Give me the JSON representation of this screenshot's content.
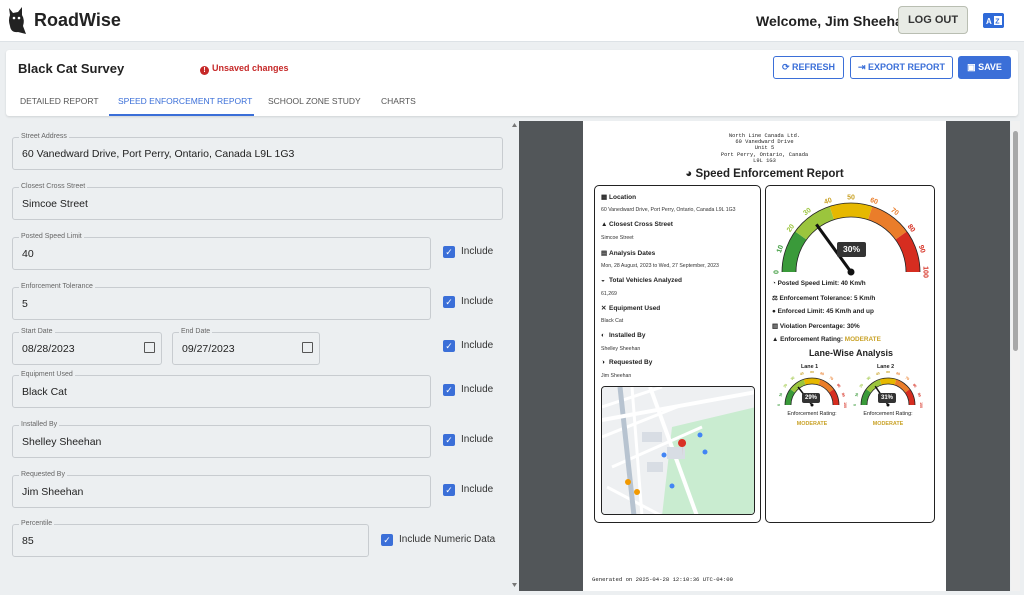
{
  "app": {
    "name": "RoadWise",
    "welcome": "Welcome, Jim Sheehan!",
    "logout_label": "LOG OUT"
  },
  "survey": {
    "title": "Black Cat Survey",
    "unsaved": "Unsaved changes",
    "buttons": {
      "refresh": "REFRESH",
      "export": "EXPORT REPORT",
      "save": "SAVE"
    },
    "tabs": [
      "DETAILED REPORT",
      "SPEED ENFORCEMENT REPORT",
      "SCHOOL ZONE STUDY",
      "CHARTS"
    ]
  },
  "form": {
    "street_address": {
      "label": "Street Address",
      "value": "60 Vanedward Drive, Port Perry, Ontario, Canada L9L 1G3"
    },
    "cross_street": {
      "label": "Closest Cross Street",
      "value": "Simcoe Street"
    },
    "speed_limit": {
      "label": "Posted Speed Limit",
      "value": "40"
    },
    "tolerance": {
      "label": "Enforcement Tolerance",
      "value": "5"
    },
    "start_date": {
      "label": "Start Date",
      "value": "08/28/2023"
    },
    "end_date": {
      "label": "End Date",
      "value": "09/27/2023"
    },
    "equipment": {
      "label": "Equipment Used",
      "value": "Black Cat"
    },
    "installed_by": {
      "label": "Installed By",
      "value": "Shelley Sheehan"
    },
    "requested_by": {
      "label": "Requested By",
      "value": "Jim Sheehan"
    },
    "percentile": {
      "label": "Percentile",
      "value": "85"
    },
    "include_label": "Include",
    "include_numeric_label": "Include Numeric Data",
    "include_states": {
      "speed_limit": true,
      "tolerance": true,
      "dates": true,
      "equipment": true,
      "installed_by": true,
      "requested_by": true,
      "numeric": true
    }
  },
  "report": {
    "address_lines": [
      "North Line Canada Ltd.",
      "60 Vanedward Drive",
      "Unit 5",
      "Port Perry, Ontario, Canada",
      "L9L 1G3"
    ],
    "title": "Speed Enforcement Report",
    "location_label": "Location",
    "location_value": "60 Vanedward Drive, Port Perry, Ontario, Canada L9L 1G3",
    "cross_label": "Closest Cross Street",
    "cross_value": "Simcoe Street",
    "dates_label": "Analysis Dates",
    "dates_value": "Mon, 28 August, 2023 to Wed, 27 September, 2023",
    "vehicles_label": "Total Vehicles Analyzed",
    "vehicles_value": "61,269",
    "equipment_label": "Equipment Used",
    "equipment_value": "Black Cat",
    "installed_label": "Installed By",
    "installed_value": "Shelley Sheehan",
    "requested_label": "Requested By",
    "requested_value": "Jim Sheehan",
    "gauge_ticks": [
      "0",
      "10",
      "20",
      "30",
      "40",
      "50",
      "60",
      "70",
      "80",
      "90",
      "100"
    ],
    "gauge_value": 30,
    "gauge_label": "30%",
    "posted_speed": "Posted Speed Limit: 40 Km/h",
    "tolerance": "Enforcement Tolerance: 5 Km/h",
    "enforced_limit": "Enforced Limit: 45 Km/h and up",
    "violation": "Violation Percentage: 30%",
    "rating_label": "Enforcement Rating:",
    "rating_value": "MODERATE",
    "lane_title": "Lane-Wise Analysis",
    "lanes": [
      {
        "name": "Lane 1",
        "value": 29,
        "label": "29%",
        "rating_label": "Enforcement Rating:",
        "rating": "MODERATE"
      },
      {
        "name": "Lane 2",
        "value": 31,
        "label": "31%",
        "rating_label": "Enforcement Rating:",
        "rating": "MODERATE"
      }
    ],
    "generated": "Generated on 2025-04-28 12:10:36 UTC-04:00"
  }
}
